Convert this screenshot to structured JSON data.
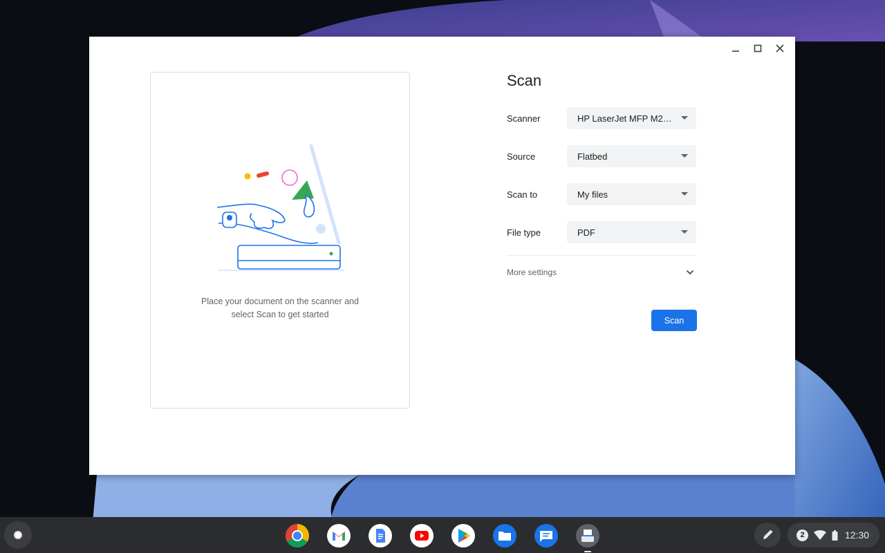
{
  "window": {
    "controls": [
      "minimize-icon",
      "maximize-icon",
      "close-icon"
    ]
  },
  "preview": {
    "message_line1": "Place your document on the scanner and",
    "message_line2": "select Scan to get started"
  },
  "settings": {
    "title": "Scan",
    "rows": [
      {
        "label": "Scanner",
        "value": "HP LaserJet MFP M29…"
      },
      {
        "label": "Source",
        "value": "Flatbed"
      },
      {
        "label": "Scan to",
        "value": "My files"
      },
      {
        "label": "File type",
        "value": "PDF"
      }
    ],
    "more_settings": "More settings",
    "scan_button": "Scan"
  },
  "shelf": {
    "apps": [
      "chrome-icon",
      "gmail-icon",
      "docs-icon",
      "youtube-icon",
      "play-store-icon",
      "files-icon",
      "messages-icon",
      "scan-app-icon"
    ],
    "notification_count": "2",
    "time": "12:30"
  },
  "colors": {
    "accent": "#1a73e8",
    "select_bg": "#f1f3f4",
    "shelf_bg": "#2b2c30"
  }
}
